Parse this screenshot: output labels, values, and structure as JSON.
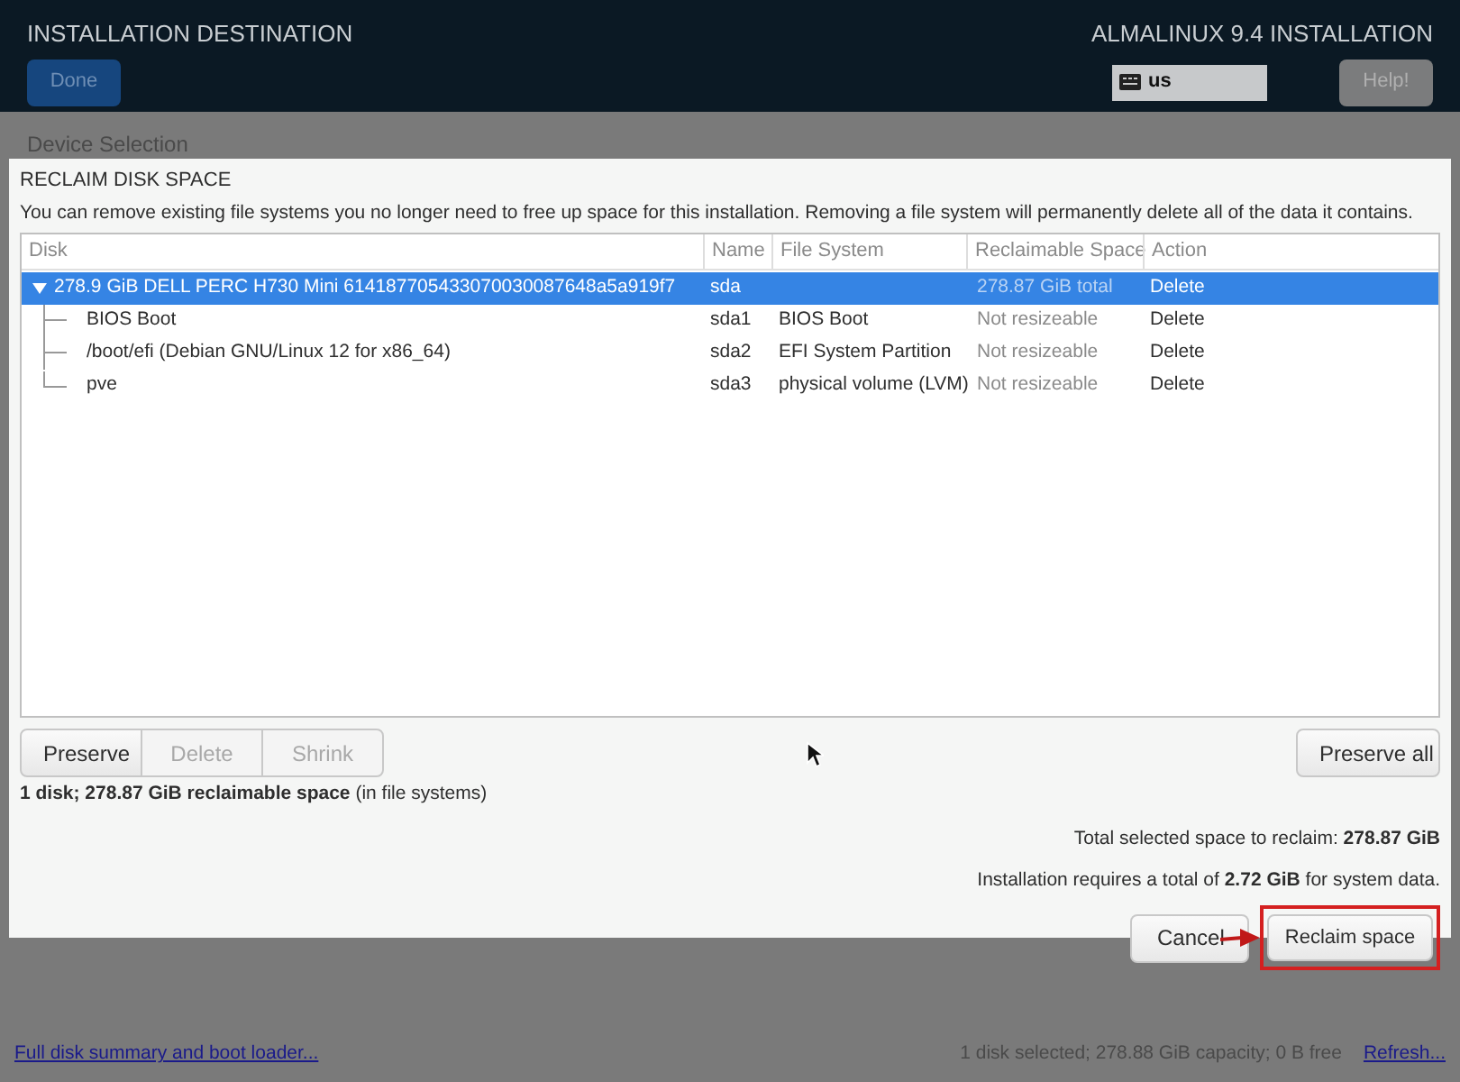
{
  "header": {
    "title": "INSTALLATION DESTINATION",
    "done_button": {
      "label": "Done",
      "disabled": true
    },
    "product": "ALMALINUX 9.4 INSTALLATION",
    "keyboard": "us",
    "help_button": {
      "label": "Help!",
      "disabled": true
    }
  },
  "page_section": "Device Selection",
  "dialog": {
    "title": "RECLAIM DISK SPACE",
    "description": "You can remove existing file systems you no longer need to free up space for this installation.  Removing a file system will permanently delete all of the data it contains.",
    "table": {
      "columns": [
        "Disk",
        "Name",
        "File System",
        "Reclaimable Space",
        "Action"
      ],
      "rows": [
        {
          "disk": "278.9 GiB DELL PERC H730 Mini 614187705433070030087648a5a919f7",
          "name": "sda",
          "file_system": "",
          "reclaimable": "278.87 GiB total",
          "action": "Delete",
          "selected": true,
          "expanded": true,
          "children": [
            {
              "disk": "BIOS Boot",
              "name": "sda1",
              "file_system": "BIOS Boot",
              "reclaimable": "Not resizeable",
              "action": "Delete",
              "selected": false
            },
            {
              "disk": "/boot/efi (Debian GNU/Linux 12 for x86_64)",
              "name": "sda2",
              "file_system": "EFI System Partition",
              "reclaimable": "Not resizeable",
              "action": "Delete",
              "selected": false
            },
            {
              "disk": "pve",
              "name": "sda3",
              "file_system": "physical volume (LVM)",
              "reclaimable": "Not resizeable",
              "action": "Delete",
              "selected": false
            }
          ]
        }
      ]
    },
    "row_buttons": [
      {
        "label": "Preserve",
        "disabled": false
      },
      {
        "label": "Delete",
        "disabled": true
      },
      {
        "label": "Shrink",
        "disabled": true
      }
    ],
    "preserve_all_button": {
      "label": "Preserve all",
      "disabled": false
    },
    "summary": "**1 disk; 278.87 GiB reclaimable space** (in file systems)",
    "total_line": "Total selected space to reclaim: **278.87 GiB**",
    "requirement_line": "Installation requires a total of **2.72 GiB** for system data.",
    "cancel_button": {
      "label": "Cancel",
      "disabled": false
    },
    "reclaim_button": {
      "label": "Reclaim space",
      "disabled": false,
      "highlighted": true
    }
  },
  "footer": {
    "link": "Full disk summary and boot loader...",
    "status": "1 disk selected; 278.88 GiB capacity; 0 B free",
    "refresh": "Refresh..."
  }
}
